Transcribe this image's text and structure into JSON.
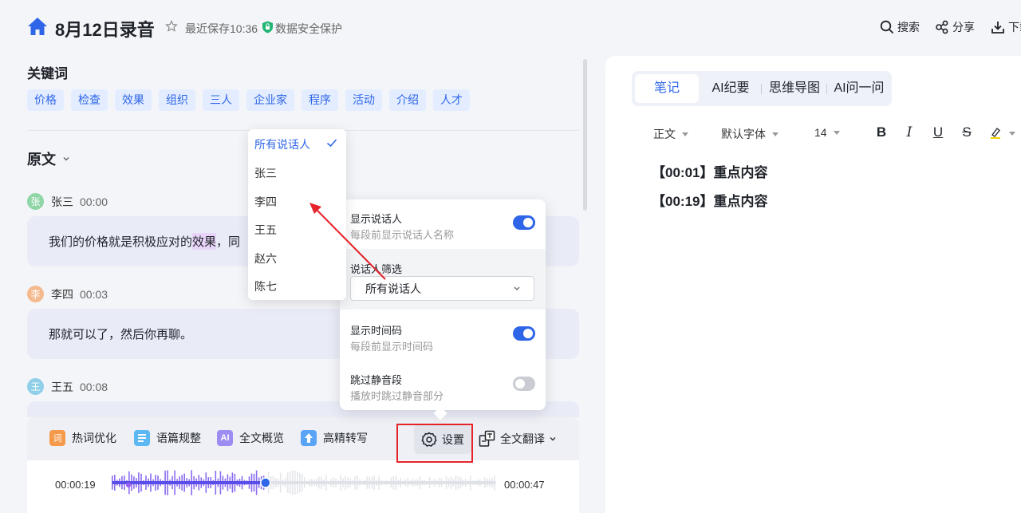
{
  "header": {
    "title": "8月12日录音",
    "save_status": "最近保存10:36",
    "security": "数据安全保护",
    "buttons": {
      "search": "搜索",
      "share": "分享",
      "download": "下载"
    }
  },
  "keywords": {
    "title": "关键词",
    "items": [
      "价格",
      "检查",
      "效果",
      "组织",
      "三人",
      "企业家",
      "程序",
      "活动",
      "介绍",
      "人才"
    ]
  },
  "transcript": {
    "title": "原文",
    "segments": [
      {
        "avatar": "张",
        "speaker": "张三",
        "time": "00:00",
        "text_plain": "我们的价格就是积极应对的",
        "text_highlight": "效果",
        "text_tail": "，同"
      },
      {
        "avatar": "李",
        "speaker": "李四",
        "time": "00:03",
        "text": "那就可以了，然后你再聊。"
      },
      {
        "avatar": "王",
        "speaker": "王五",
        "time": "00:08"
      }
    ]
  },
  "toolbar": {
    "hotword": "热词优化",
    "hotword_icon": "词",
    "paragraph": "语篇规整",
    "overview": "全文概览",
    "overview_icon": "AI",
    "hd": "高精转写",
    "settings": "设置",
    "translate": "全文翻译"
  },
  "player": {
    "current": "00:00:19",
    "total": "00:00:47",
    "progress": 0.4
  },
  "speaker_dropdown": {
    "options": [
      "所有说话人",
      "张三",
      "李四",
      "王五",
      "赵六",
      "陈七"
    ],
    "selected": "所有说话人"
  },
  "settings_panel": {
    "show_speaker": {
      "title": "显示说话人",
      "desc": "每段前显示说话人名称",
      "on": true
    },
    "speaker_filter": {
      "title": "说话人筛选",
      "value": "所有说话人"
    },
    "show_timecode": {
      "title": "显示时间码",
      "desc": "每段前显示时间码",
      "on": true
    },
    "skip_silence": {
      "title": "跳过静音段",
      "desc": "播放时跳过静音部分",
      "on": false
    }
  },
  "notes": {
    "tabs": [
      "笔记",
      "AI纪要",
      "思维导图",
      "AI问一问"
    ],
    "active_tab": "笔记",
    "format": {
      "style": "正文",
      "font": "默认字体",
      "size": "14"
    },
    "lines": [
      "【00:01】重点内容",
      "【00:19】重点内容"
    ]
  },
  "colors": {
    "accent": "#2f66e8",
    "annotation_red": "#e5242b"
  }
}
